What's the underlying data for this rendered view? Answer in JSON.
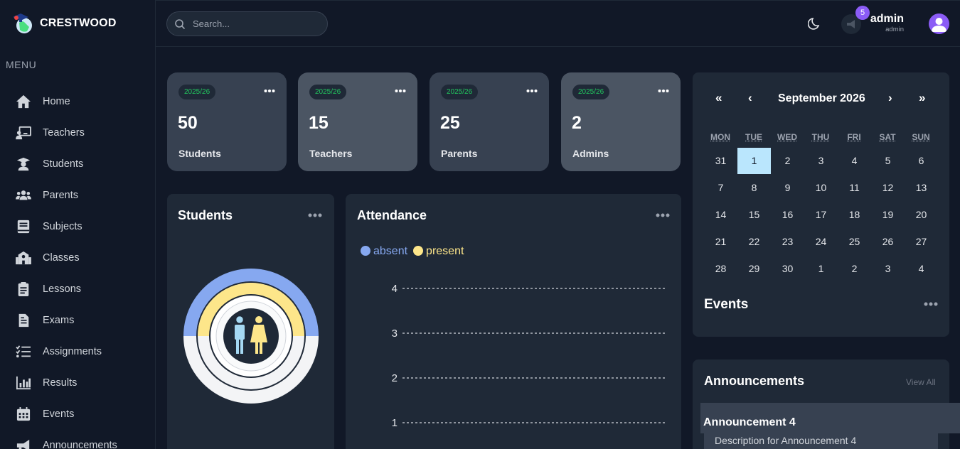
{
  "brand": {
    "name": "CRESTWOOD"
  },
  "menu": {
    "label": "MENU",
    "items": [
      {
        "label": "Home",
        "icon": "home-icon"
      },
      {
        "label": "Teachers",
        "icon": "teacher-icon"
      },
      {
        "label": "Students",
        "icon": "student-icon"
      },
      {
        "label": "Parents",
        "icon": "parents-icon"
      },
      {
        "label": "Subjects",
        "icon": "book-icon"
      },
      {
        "label": "Classes",
        "icon": "school-icon"
      },
      {
        "label": "Lessons",
        "icon": "clipboard-icon"
      },
      {
        "label": "Exams",
        "icon": "document-icon"
      },
      {
        "label": "Assignments",
        "icon": "checklist-icon"
      },
      {
        "label": "Results",
        "icon": "bar-chart-icon"
      },
      {
        "label": "Events",
        "icon": "calendar-icon"
      },
      {
        "label": "Announcements",
        "icon": "megaphone-icon"
      }
    ]
  },
  "topbar": {
    "search_placeholder": "Search...",
    "notification_count": "5",
    "user_name": "admin",
    "user_role": "admin"
  },
  "stats": [
    {
      "year": "2025/26",
      "value": "50",
      "label": "Students"
    },
    {
      "year": "2025/26",
      "value": "15",
      "label": "Teachers"
    },
    {
      "year": "2025/26",
      "value": "25",
      "label": "Parents"
    },
    {
      "year": "2025/26",
      "value": "2",
      "label": "Admins"
    }
  ],
  "students_panel": {
    "title": "Students"
  },
  "attendance": {
    "title": "Attendance",
    "legend": [
      {
        "label": "absent",
        "color": "#86a8f0"
      },
      {
        "label": "present",
        "color": "#fde68a"
      }
    ],
    "y_ticks": [
      "4",
      "3",
      "2",
      "1"
    ]
  },
  "calendar": {
    "prev_year": "«",
    "prev_month": "‹",
    "month": "September 2026",
    "next_month": "›",
    "next_year": "»",
    "weekdays": [
      "MON",
      "TUE",
      "WED",
      "THU",
      "FRI",
      "SAT",
      "SUN"
    ],
    "weeks": [
      [
        "31",
        "1",
        "2",
        "3",
        "4",
        "5",
        "6"
      ],
      [
        "7",
        "8",
        "9",
        "10",
        "11",
        "12",
        "13"
      ],
      [
        "14",
        "15",
        "16",
        "17",
        "18",
        "19",
        "20"
      ],
      [
        "21",
        "22",
        "23",
        "24",
        "25",
        "26",
        "27"
      ],
      [
        "28",
        "29",
        "30",
        "1",
        "2",
        "3",
        "4"
      ]
    ],
    "today": "1"
  },
  "events": {
    "title": "Events"
  },
  "announcements": {
    "title": "Announcements",
    "view_all": "View All",
    "items": [
      {
        "title": "Announcement 4",
        "description": "Description for Announcement 4"
      }
    ]
  },
  "colors": {
    "accent": "#8b5cf6",
    "year_pill_text": "#22c55e",
    "today_highlight": "#bae6fd"
  }
}
